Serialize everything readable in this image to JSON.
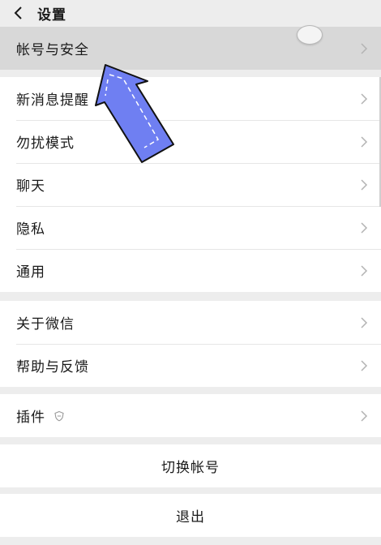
{
  "header": {
    "title": "设置",
    "back_icon": "chevron-left-icon"
  },
  "groups": [
    {
      "items": [
        {
          "label": "帐号与安全",
          "highlighted": true
        }
      ]
    },
    {
      "items": [
        {
          "label": "新消息提醒"
        },
        {
          "label": "勿扰模式"
        },
        {
          "label": "聊天"
        },
        {
          "label": "隐私"
        },
        {
          "label": "通用"
        }
      ]
    },
    {
      "items": [
        {
          "label": "关于微信"
        },
        {
          "label": "帮助与反馈"
        }
      ]
    },
    {
      "items": [
        {
          "label": "插件",
          "icon": "plugin-shield-icon"
        }
      ]
    }
  ],
  "actions": {
    "switch_account": "切换帐号",
    "logout": "退出"
  },
  "colors": {
    "background": "#ededed",
    "row_background": "#ffffff",
    "highlight": "#d8d8d8",
    "arrow_fill": "#6f7ff2",
    "chevron": "#b3b3b3"
  }
}
